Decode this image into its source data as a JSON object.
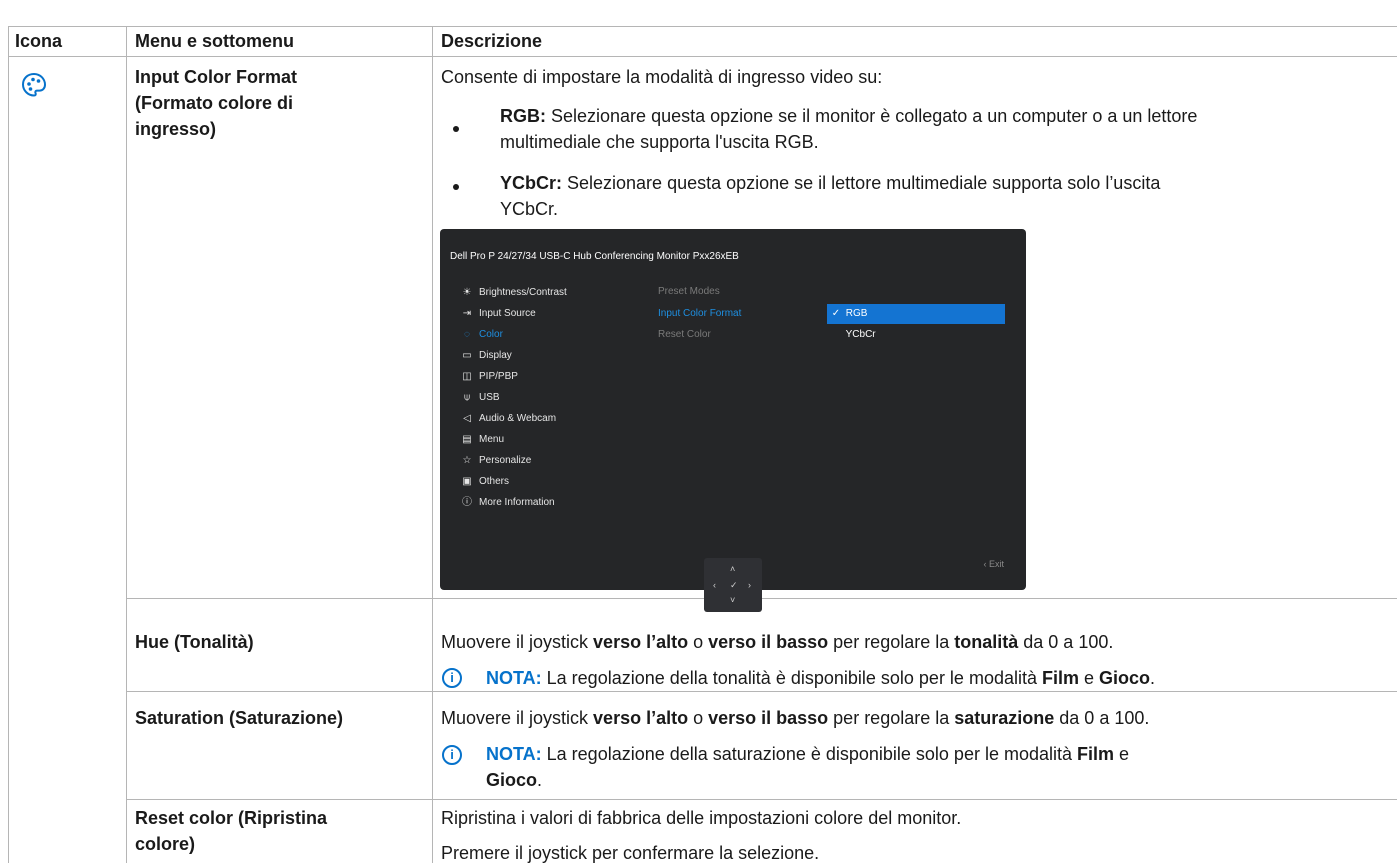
{
  "header": {
    "col_icon": "Icona",
    "col_menu": "Menu e sottomenu",
    "col_desc": "Descrizione"
  },
  "row1": {
    "icon": "palette-icon",
    "menu_line1": "Input Color Format",
    "menu_line2": "(Formato colore di",
    "menu_line3": "ingresso)",
    "intro": "Consente di impostare la modalità di ingresso video su:",
    "b1_label": "RGB:",
    "b1_text_l1": " Selezionare questa opzione se il monitor è collegato a un computer o a un lettore",
    "b1_text_l2": "multimediale che supporta l'uscita RGB.",
    "b2_label": "YCbCr:",
    "b2_text_l1": " Selezionare questa opzione se il lettore multimediale supporta solo l’uscita",
    "b2_text_l2": "YCbCr."
  },
  "osd": {
    "title": "Dell Pro P 24/27/34 USB-C Hub Conferencing Monitor  Pxx26xEB",
    "menu": [
      {
        "icon": "sun-icon",
        "glyph": "☀",
        "label": "Brightness/Contrast"
      },
      {
        "icon": "input-icon",
        "glyph": "⇥",
        "label": "Input Source"
      },
      {
        "icon": "palette-icon",
        "glyph": "◌",
        "label": "Color"
      },
      {
        "icon": "display-icon",
        "glyph": "▭",
        "label": "Display"
      },
      {
        "icon": "pip-icon",
        "glyph": "◫",
        "label": "PIP/PBP"
      },
      {
        "icon": "usb-icon",
        "glyph": "⍦",
        "label": "USB"
      },
      {
        "icon": "speaker-icon",
        "glyph": "◁",
        "label": "Audio & Webcam"
      },
      {
        "icon": "menu-icon",
        "glyph": "▤",
        "label": "Menu"
      },
      {
        "icon": "star-icon",
        "glyph": "☆",
        "label": "Personalize"
      },
      {
        "icon": "others-icon",
        "glyph": "▣",
        "label": "Others"
      },
      {
        "icon": "info-icon",
        "glyph": "ⓘ",
        "label": "More Information"
      }
    ],
    "submenu": [
      "Preset Modes",
      "Input Color Format",
      "Reset Color"
    ],
    "options": [
      "RGB",
      "YCbCr"
    ],
    "check": "✓",
    "exit": "‹  Exit",
    "joystick": {
      "up": "˄",
      "left": "‹",
      "center": "✓",
      "right": "›",
      "down": "˅"
    },
    "accent_color": "#1474d2"
  },
  "row2": {
    "menu": "Hue (Tonalità)",
    "desc_a": "Muovere il joystick ",
    "desc_b": "verso l’alto",
    "desc_c": " o ",
    "desc_d": "verso il basso",
    "desc_e": " per regolare la ",
    "desc_f": "tonalità",
    "desc_g": " da 0 a 100.",
    "nota_label": "NOTA:",
    "nota_a": " La regolazione della tonalità è disponibile solo per le modalità ",
    "nota_b": "Film",
    "nota_c": " e ",
    "nota_d": "Gioco",
    "nota_e": "."
  },
  "row3": {
    "menu": "Saturation (Saturazione)",
    "desc_a": "Muovere il joystick ",
    "desc_b": "verso l’alto",
    "desc_c": " o ",
    "desc_d": "verso il basso",
    "desc_e": " per regolare la ",
    "desc_f": "saturazione",
    "desc_g": " da 0 a 100.",
    "nota_label": "NOTA:",
    "nota_a": " La regolazione della saturazione è disponibile solo per le modalità ",
    "nota_b": "Film",
    "nota_c": " e",
    "nota_d": "Gioco",
    "nota_e": "."
  },
  "row4": {
    "menu_line1": "Reset color (Ripristina",
    "menu_line2": "colore)",
    "desc1": "Ripristina i valori di fabbrica delle impostazioni colore del monitor.",
    "desc2": "Premere il joystick per confermare la selezione."
  },
  "info_glyph": "i"
}
